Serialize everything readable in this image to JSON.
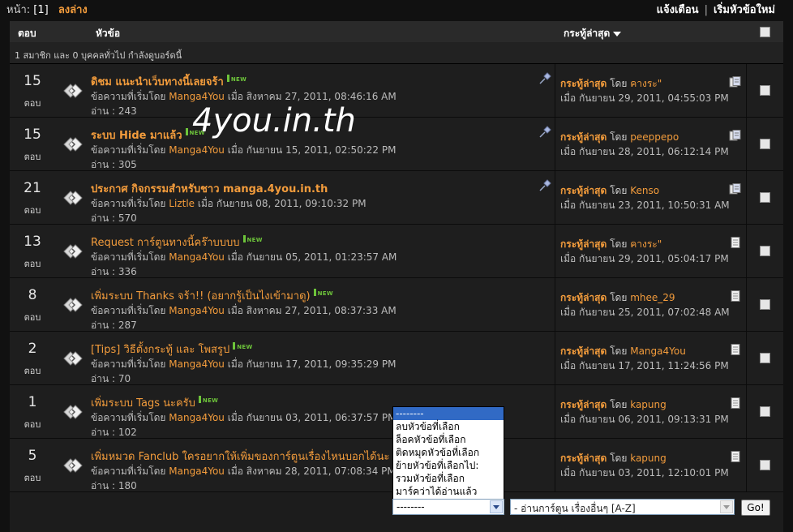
{
  "top": {
    "page_label": "หน้า:",
    "page_current": "[1]",
    "go_down": "ลงล่าง",
    "notify": "แจ้งเตือน",
    "separator": "|",
    "new_topic": "เริ่มหัวข้อใหม่"
  },
  "header": {
    "replies": "ตอบ",
    "subject": "หัวข้อ",
    "last_post": "กระทู้ล่าสุด"
  },
  "online_info": "1 สมาชิก และ 0 บุคคลทั่วไป กำลังดูบอร์ดนี้",
  "watermark": "4you.in.th",
  "topics": [
    {
      "replies": "15",
      "replies_label": "ตอบ",
      "title": "ดิชม แนะนำเว็บทางนี้เลยจร้า",
      "bold": true,
      "new": true,
      "pinned": true,
      "started_by": "ข้อความที่เริ่มโดย",
      "author": "Manga4You",
      "date_prefix": "เมื่อ",
      "date": "สิงหาคม 27, 2011, 08:46:16 AM",
      "reads": "อ่าน : 243",
      "last_label": "กระทู้ล่าสุด",
      "by": "โดย",
      "last_user": "คางระ\"",
      "last_date": "เมื่อ กันยายน 29, 2011, 04:55:03 PM",
      "multi_icon": true
    },
    {
      "replies": "15",
      "replies_label": "ตอบ",
      "title": "ระบบ Hide มาแล้ว",
      "bold": true,
      "new": true,
      "pinned": true,
      "started_by": "ข้อความที่เริ่มโดย",
      "author": "Manga4You",
      "date_prefix": "เมื่อ",
      "date": "กันยายน 15, 2011, 02:50:22 PM",
      "reads": "อ่าน : 305",
      "last_label": "กระทู้ล่าสุด",
      "by": "โดย",
      "last_user": "peeppepo",
      "last_date": "เมื่อ กันยายน 28, 2011, 06:12:14 PM",
      "multi_icon": true
    },
    {
      "replies": "21",
      "replies_label": "ตอบ",
      "title": "ประกาศ กิจกรรมสำหรับชาว manga.4you.in.th",
      "bold": true,
      "new": false,
      "pinned": true,
      "started_by": "ข้อความที่เริ่มโดย",
      "author": "Liztle",
      "date_prefix": "เมื่อ",
      "date": "กันยายน 08, 2011, 09:10:32 PM",
      "reads": "อ่าน : 570",
      "last_label": "กระทู้ล่าสุด",
      "by": "โดย",
      "last_user": "Kenso",
      "last_date": "เมื่อ กันยายน 23, 2011, 10:50:31 AM",
      "multi_icon": true
    },
    {
      "replies": "13",
      "replies_label": "ตอบ",
      "title": "Request การ์ตูนทางนี้คร๊าบบบบ",
      "bold": false,
      "new": true,
      "pinned": false,
      "started_by": "ข้อความที่เริ่มโดย",
      "author": "Manga4You",
      "date_prefix": "เมื่อ",
      "date": "กันยายน 05, 2011, 01:23:57 AM",
      "reads": "อ่าน : 336",
      "last_label": "กระทู้ล่าสุด",
      "by": "โดย",
      "last_user": "คางระ\"",
      "last_date": "เมื่อ กันยายน 29, 2011, 05:04:17 PM",
      "multi_icon": false
    },
    {
      "replies": "8",
      "replies_label": "ตอบ",
      "title": "เพิ่มระบบ Thanks จร้า!! (อยากรู้เป็นไงเข้ามาดู)",
      "bold": false,
      "new": true,
      "pinned": false,
      "started_by": "ข้อความที่เริ่มโดย",
      "author": "Manga4You",
      "date_prefix": "เมื่อ",
      "date": "สิงหาคม 27, 2011, 08:37:33 AM",
      "reads": "อ่าน : 287",
      "last_label": "กระทู้ล่าสุด",
      "by": "โดย",
      "last_user": "mhee_29",
      "last_date": "เมื่อ กันยายน 25, 2011, 07:02:48 AM",
      "multi_icon": false
    },
    {
      "replies": "2",
      "replies_label": "ตอบ",
      "title": "[Tips] วิธีตั้งกระทู้ และ โพสรูป",
      "bold": false,
      "new": true,
      "pinned": false,
      "started_by": "ข้อความที่เริ่มโดย",
      "author": "Manga4You",
      "date_prefix": "เมื่อ",
      "date": "กันยายน 17, 2011, 09:35:29 PM",
      "reads": "อ่าน : 70",
      "last_label": "กระทู้ล่าสุด",
      "by": "โดย",
      "last_user": "Manga4You",
      "last_date": "เมื่อ กันยายน 17, 2011, 11:24:56 PM",
      "multi_icon": false
    },
    {
      "replies": "1",
      "replies_label": "ตอบ",
      "title": "เพิ่มระบบ Tags นะครับ",
      "bold": false,
      "new": true,
      "pinned": false,
      "started_by": "ข้อความที่เริ่มโดย",
      "author": "Manga4You",
      "date_prefix": "เมื่อ",
      "date": "กันยายน 03, 2011, 06:37:57 PM",
      "reads": "อ่าน : 102",
      "last_label": "กระทู้ล่าสุด",
      "by": "โดย",
      "last_user": "kapung",
      "last_date": "เมื่อ กันยายน 06, 2011, 09:13:31 PM",
      "multi_icon": false
    },
    {
      "replies": "5",
      "replies_label": "ตอบ",
      "title": "เพิ่มหมวด Fanclub ใครอยากให้เพิ่มของการ์ตูนเรื่องไหนบอกได้นะ",
      "bold": false,
      "new": false,
      "pinned": false,
      "started_by": "ข้อความที่เริ่มโดย",
      "author": "Manga4You",
      "date_prefix": "เมื่อ",
      "date": "สิงหาคม 28, 2011, 07:08:34 PM",
      "reads": "อ่าน : 180",
      "last_label": "กระทู้ล่าสุด",
      "by": "โดย",
      "last_user": "kapung",
      "last_date": "เมื่อ กันยายน 03, 2011, 12:10:01 PM",
      "multi_icon": false
    }
  ],
  "new_badge": "NEW",
  "quick_mod": {
    "selected": "--------",
    "options": [
      "--------",
      "ลบหัวข้อที่เลือก",
      "ล็อคหัวข้อที่เลือก",
      "ติดหมุดหัวข้อที่เลือก",
      "ย้ายหัวข้อที่เลือกไป:",
      "รวมหัวข้อที่เลือก",
      "มาร์คว่าได้อ่านแล้ว"
    ]
  },
  "move_target": "- อ่านการ์ตูน เรื่องอื่นๆ [A-Z]",
  "go_button": "Go!"
}
